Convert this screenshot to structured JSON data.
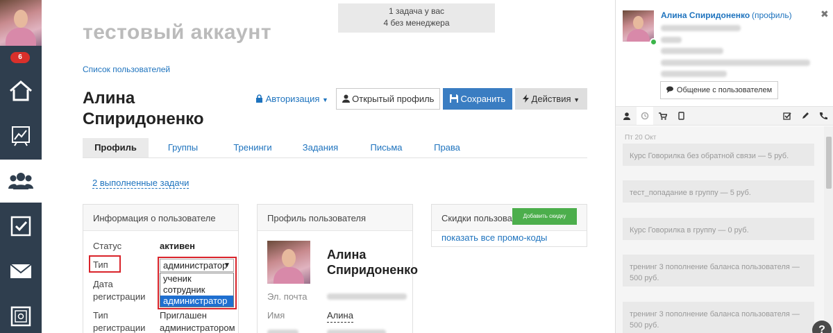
{
  "sidebar": {
    "badge": "6",
    "items": [
      {
        "icon": "home-icon"
      },
      {
        "icon": "chart-icon"
      },
      {
        "icon": "users-icon"
      },
      {
        "icon": "tasks-icon"
      },
      {
        "icon": "mail-icon"
      },
      {
        "icon": "safe-icon"
      }
    ],
    "colors": {
      "bg": "#2f3e4e",
      "active_bg": "#ffffff",
      "badge": "#d9302b"
    }
  },
  "top_note": {
    "line1": "1 задача у вас",
    "line2": "4 без менеджера"
  },
  "header": {
    "account_title": "тестовый аккаунт",
    "breadcrumb": "Список пользователей",
    "user_name": "Алина Спиридоненко",
    "auth_label": "Авторизация",
    "open_profile_label": "Открытый профиль",
    "save_label": "Сохранить",
    "actions_label": "Действия"
  },
  "tabs": [
    {
      "label": "Профиль",
      "active": true
    },
    {
      "label": "Группы"
    },
    {
      "label": "Тренинги"
    },
    {
      "label": "Задания"
    },
    {
      "label": "Письма"
    },
    {
      "label": "Права"
    }
  ],
  "done_tasks_link": "2 выполненные задачи",
  "user_info": {
    "title": "Информация о пользователе",
    "status_label": "Статус",
    "status_value": "активен",
    "type_label": "Тип",
    "type_value": "администратор",
    "type_options": [
      "ученик",
      "сотрудник",
      "администратор"
    ],
    "reg_date_label_1": "Дата",
    "reg_date_label_2": "регистрации",
    "reg_type_label_1": "Тип",
    "reg_type_label_2": "регистрации",
    "reg_type_value_1": "Приглашен",
    "reg_type_value_2": "администратором"
  },
  "profile_panel": {
    "title": "Профиль пользователя",
    "name_line1": "Алина",
    "name_line2": "Спиридоненко",
    "email_label": "Эл. почта",
    "name_label": "Имя",
    "name_value": "Алина"
  },
  "discounts_panel": {
    "title": "Скидки пользователя",
    "add_button": "Добавить скидку",
    "promo_link": "показать все промо-коды"
  },
  "right_panel": {
    "name": "Алина Спиридоненко",
    "profile_link": "(профиль)",
    "contact_button": "Общение с пользователем",
    "tabs": [
      "user-icon",
      "history-icon",
      "cart-icon",
      "tablet-icon",
      "checkbox-icon",
      "pencil-icon",
      "phone-icon"
    ],
    "feed_date": "Пт 20 Окт",
    "feed": [
      "Курс Говорилка без обратной связи — 5 руб.",
      "тест_попадание в группу — 5 руб.",
      "Курс Говорилка в группу — 0 руб.",
      "тренинг 3 пополнение баланса пользователя — 500 руб.",
      "тренинг 3 пополнение баланса пользователя — 500 руб."
    ]
  },
  "help_label": "?"
}
